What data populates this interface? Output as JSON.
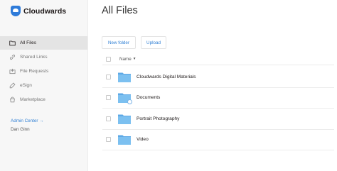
{
  "brand": {
    "name": "Cloudwards",
    "color": "#2e7bd9"
  },
  "sidebar": {
    "items": [
      {
        "label": "All Files",
        "icon": "folder-icon",
        "active": true
      },
      {
        "label": "Shared Links",
        "icon": "link-icon",
        "active": false
      },
      {
        "label": "File Requests",
        "icon": "file-request-icon",
        "active": false
      },
      {
        "label": "eSign",
        "icon": "esign-icon",
        "active": false
      },
      {
        "label": "Marketplace",
        "icon": "marketplace-icon",
        "active": false
      }
    ],
    "admin_link": "Admin Center →",
    "user_name": "Dan Ginn"
  },
  "main": {
    "title": "All Files",
    "buttons": {
      "new_folder": "New folder",
      "upload": "Upload"
    },
    "columns": {
      "name": "Name",
      "sort_icon": "caret-down-icon"
    },
    "files": [
      {
        "name": "Cloudwards Digital Materials",
        "type": "folder",
        "shared": false
      },
      {
        "name": "Documents",
        "type": "folder",
        "shared": true
      },
      {
        "name": "Portrait Photography",
        "type": "folder",
        "shared": false
      },
      {
        "name": "Video",
        "type": "folder",
        "shared": false
      }
    ]
  },
  "colors": {
    "accent": "#2f7fd4",
    "folder": "#6fb6ec",
    "active_bg": "#e4e4e4"
  }
}
